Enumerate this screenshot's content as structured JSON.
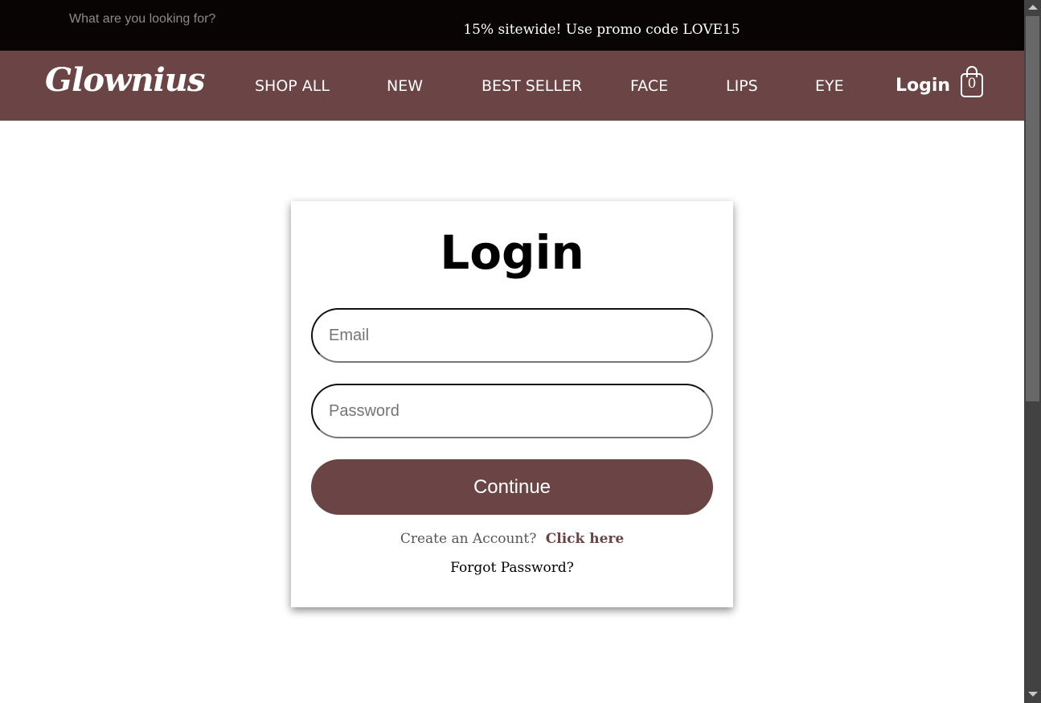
{
  "header": {
    "search_placeholder": "What are you looking for?",
    "promo": "15% sitewide! Use promo code LOVE15"
  },
  "nav": {
    "logo": "Glownius",
    "items": [
      {
        "label": "SHOP ALL"
      },
      {
        "label": "NEW"
      },
      {
        "label": "BEST SELLER"
      },
      {
        "label": "FACE"
      },
      {
        "label": "LIPS"
      },
      {
        "label": "EYE"
      }
    ],
    "login": "Login",
    "cart_count": "0",
    "cart_icon": "shopping-bag-icon"
  },
  "login_form": {
    "title": "Login",
    "email_placeholder": "Email",
    "password_placeholder": "Password",
    "continue_label": "Continue",
    "create_account_text": "Create an Account?",
    "click_here": "Click here",
    "forgot_password": "Forgot Password?"
  },
  "colors": {
    "brand": "#6b4545",
    "topbar": "#080404"
  }
}
